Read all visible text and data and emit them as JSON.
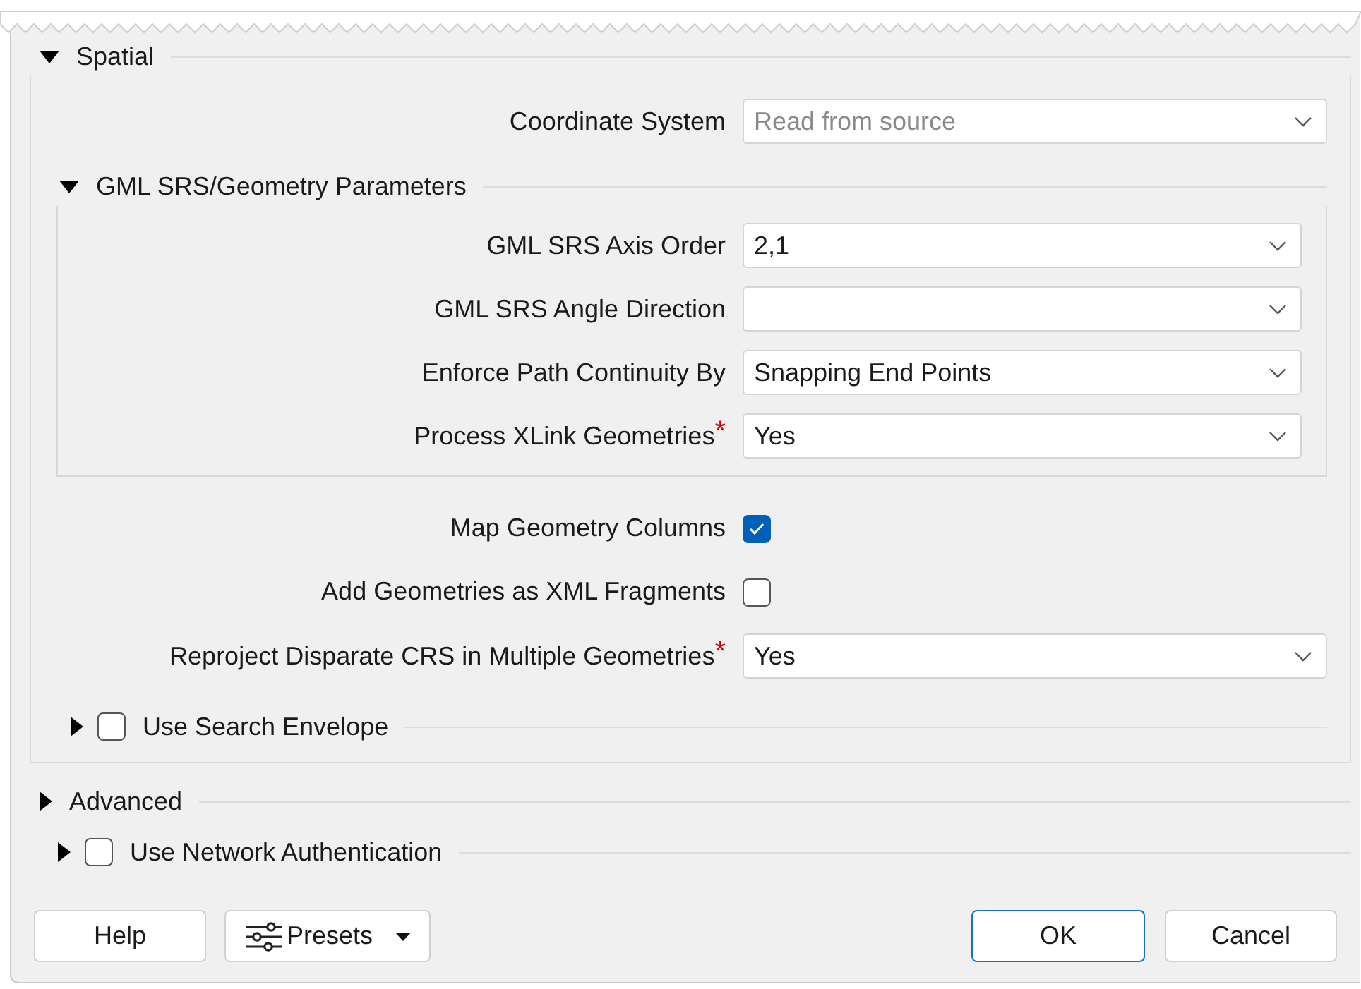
{
  "spatial": {
    "label": "Spatial",
    "expanded": true,
    "coordinate_system": {
      "label": "Coordinate System",
      "value": "Read from source",
      "disabled": true
    },
    "gml_group": {
      "label": "GML SRS/Geometry Parameters",
      "expanded": true,
      "fields": [
        {
          "label": "GML SRS Axis Order",
          "value": "2,1"
        },
        {
          "label": "GML SRS Angle Direction"
        },
        {
          "label": "Enforce Path Continuity By",
          "value": "Snapping End Points"
        },
        {
          "label": "Process XLink Geometries",
          "required_mark": "*",
          "value": "Yes"
        }
      ]
    },
    "options": [
      {
        "kind": "checkbox",
        "label": "Map Geometry Columns",
        "checked": true
      },
      {
        "kind": "checkbox",
        "label": "Add Geometries as XML Fragments",
        "checked": false
      },
      {
        "kind": "combo",
        "label": "Reproject Disparate CRS in Multiple Geometries",
        "required_mark": "*",
        "value": "Yes"
      }
    ],
    "search_envelope": {
      "label": "Use Search Envelope",
      "expanded": false,
      "checked": false
    }
  },
  "advanced": {
    "label": "Advanced",
    "expanded": false
  },
  "network_auth": {
    "label": "Use Network Authentication",
    "expanded": false,
    "checked": false
  },
  "buttons": [
    {
      "kind": "plain",
      "label": "Help"
    },
    {
      "kind": "presets",
      "label": "Presets"
    },
    {
      "kind": "default",
      "label": "OK"
    },
    {
      "kind": "plain",
      "label": "Cancel"
    }
  ]
}
